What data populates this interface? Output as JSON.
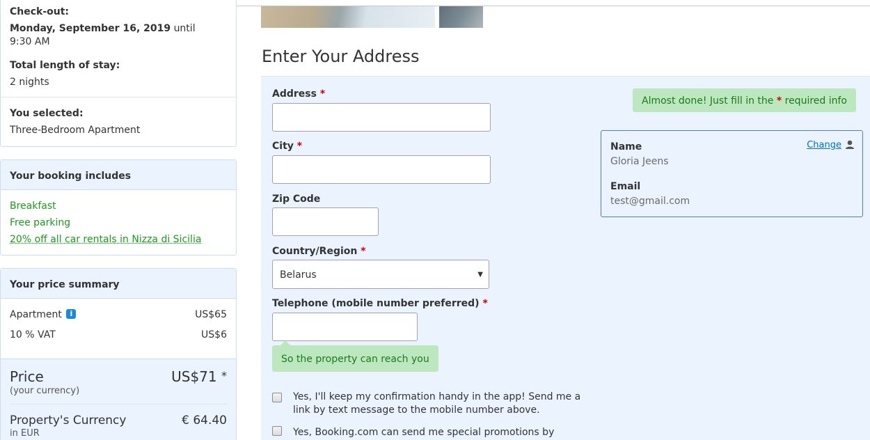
{
  "stay": {
    "checkout_label": "Check-out:",
    "checkout_date": "Monday, September 16, 2019",
    "checkout_until": "until",
    "checkout_time": "9:30 AM",
    "length_label": "Total length of stay:",
    "length_value": "2 nights",
    "selected_label": "You selected:",
    "selected_value": "Three-Bedroom Apartment"
  },
  "includes": {
    "title": "Your booking includes",
    "items": [
      "Breakfast",
      "Free parking",
      "20% off all car rentals in Nizza di Sicilia"
    ]
  },
  "price_summary": {
    "title": "Your price summary",
    "rows": [
      {
        "label": "Apartment",
        "value": "US$65"
      },
      {
        "label": "10 % VAT",
        "value": "US$6"
      }
    ],
    "price_label": "Price",
    "price_sub": "(your currency)",
    "price_value": "US$71",
    "price_star": "*",
    "property_label": "Property's Currency",
    "property_sub": "in EUR",
    "property_value": "€ 64.40"
  },
  "form": {
    "heading": "Enter Your Address",
    "required_mark": "*",
    "address_label": "Address",
    "city_label": "City",
    "zip_label": "Zip Code",
    "country_label": "Country/Region",
    "country_value": "Belarus",
    "phone_label": "Telephone (mobile number preferred)",
    "phone_hint": "So the property can reach you",
    "almost_done_pre": "Almost done! Just fill in the",
    "almost_done_star": "*",
    "almost_done_post": "required info",
    "checkbox1": "Yes, I'll keep my confirmation handy in the app! Send me a link by text message to the mobile number above.",
    "checkbox2": "Yes, Booking.com can send me special promotions by"
  },
  "guest": {
    "change_label": "Change",
    "name_label": "Name",
    "name_value": "Gloria Jeens",
    "email_label": "Email",
    "email_value": "test@gmail.com"
  },
  "colors": {
    "accent_blue": "#0071c2",
    "panel_bg": "#ebf3ff",
    "success_green": "#1d9a1d",
    "required_red": "#cc0000"
  },
  "icons": {
    "info": "info-icon",
    "person": "person-icon",
    "dropdown": "chevron-down-icon"
  }
}
